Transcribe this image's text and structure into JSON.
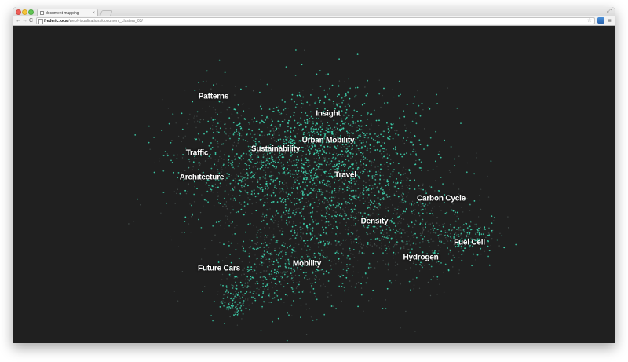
{
  "browser": {
    "tab_title": "document mapping",
    "url_host": "frederic.local",
    "url_path": "/web/visualizations/document_clusters_03/",
    "tab_close_glyph": "×",
    "fullscreen_glyph": "⤢",
    "back_glyph": "←",
    "forward_glyph": "→",
    "reload_glyph": "C",
    "star_glyph": "☆",
    "menu_glyph": "≡"
  },
  "colors": {
    "background": "#202020",
    "point": "#3ed6b0",
    "point_faint": "#5a6a66",
    "label": "#ffffff"
  },
  "clusters": [
    {
      "label": "Patterns"
    },
    {
      "label": "Insight"
    },
    {
      "label": "Urban Mobility"
    },
    {
      "label": "Sustainability"
    },
    {
      "label": "Traffic"
    },
    {
      "label": "Architecture"
    },
    {
      "label": "Travel"
    },
    {
      "label": "Carbon Cycle"
    },
    {
      "label": "Density"
    },
    {
      "label": "Fuel Cell"
    },
    {
      "label": "Hydrogen"
    },
    {
      "label": "Future Cars"
    },
    {
      "label": "Mobility"
    }
  ]
}
